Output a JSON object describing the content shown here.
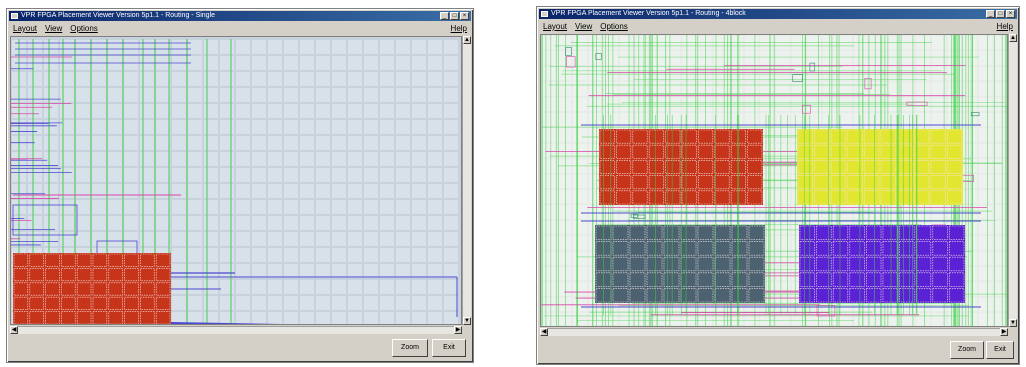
{
  "windows": [
    {
      "title": "VPR FPGA Placement Viewer  Version 5p1.1 - Routing - Single",
      "menu": [
        "Layout",
        "View",
        "Options"
      ],
      "help_label": "Help",
      "buttons": {
        "zoom_label": "Zoom",
        "exit_label": "Exit"
      }
    },
    {
      "title": "VPR FPGA Placement Viewer  Version 5p1.1 - Routing - 4block",
      "menu": [
        "Layout",
        "View",
        "Options"
      ],
      "help_label": "Help",
      "buttons": {
        "zoom_label": "Zoom",
        "exit_label": "Exit"
      }
    }
  ],
  "colors": {
    "grid_bg_1": "#c8d2de",
    "grid_line": "#ffffff",
    "route_green": "#3fd14a",
    "route_blue": "#4a4ad0",
    "route_pink": "#d848a8",
    "block_red": "#c6341a",
    "block_yellow": "#e2e630",
    "block_slate": "#4c6270",
    "block_violet": "#5a22d4"
  }
}
